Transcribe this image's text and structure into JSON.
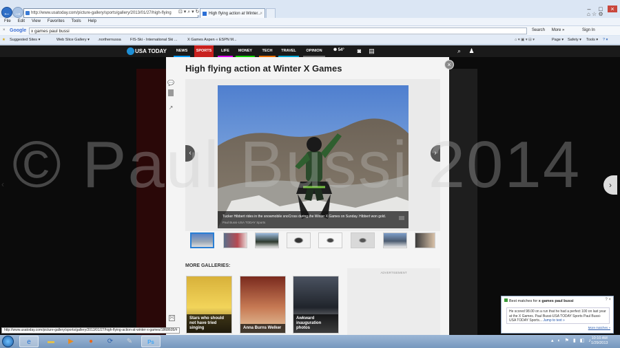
{
  "browser": {
    "url": "http://www.usatoday.com/picture-gallery/sports/gallery/2013/01/27/high-flying",
    "tab_title": "High flying action at Winter...",
    "menu": [
      "File",
      "Edit",
      "View",
      "Favorites",
      "Tools",
      "Help"
    ],
    "google_query": "x games paul bussi",
    "google_label": "Google",
    "google_right": [
      "Search",
      "More »",
      "Sign In"
    ],
    "favorites": [
      "Suggested Sites ▾",
      "Web Slice Gallery ▾",
      ".northernussa",
      "FIS-Ski - International Ski ...",
      "X Games Aspen « ESPN M..."
    ],
    "toolbar_right": [
      "Page ▾",
      "Safety ▾",
      "Tools ▾"
    ],
    "status_url": "http://www.usatoday.com/picture-gallery/sports/gallery/2013/01/27/high-flying-action-at-winter-x-games/1868605/#"
  },
  "site": {
    "logo": "USA TODAY",
    "nav": [
      {
        "label": "NEWS",
        "color": "#1a1a1a",
        "underline": "#0098fe"
      },
      {
        "label": "SPORTS",
        "color": "#c8201d",
        "underline": "#c8201d"
      },
      {
        "label": "LIFE",
        "color": "#1a1a1a",
        "underline": "#db00f0"
      },
      {
        "label": "MONEY",
        "color": "#1a1a1a",
        "underline": "#0fd400"
      },
      {
        "label": "TECH",
        "color": "#1a1a1a",
        "underline": "#e86c00"
      },
      {
        "label": "TRAVEL",
        "color": "#1a1a1a",
        "underline": "#00a5d6"
      },
      {
        "label": "OPINION",
        "color": "#1a1a1a",
        "underline": "#6a6a6a"
      }
    ],
    "weather": "54°"
  },
  "gallery": {
    "title": "High flying action at Winter X Games",
    "caption": "Tucker Hibbert rides in the snowmobile snoCross during the Winter X Games on Sunday. Hibbert won gold.",
    "credit": "Paul Bussi-USA TODAY Sports",
    "selected_thumb": 0,
    "thumb_count": 9,
    "more_header": "MORE GALLERIES:",
    "more": [
      {
        "label": "Stars who should not have tried singing"
      },
      {
        "label": "Anna Burns Welker"
      },
      {
        "label": "Awkward inauguration photos"
      }
    ],
    "ad_label": "ADVERTISEMENT"
  },
  "watermark": "© Paul Bussi 2014",
  "popup": {
    "title_prefix": "Best matches for ",
    "title_query": "x games paul bussi",
    "body_text": "He scored 98.00 on a run that he had a perfect 100 on last year at the X Games. Paul Bussi-USA TODAY Sports Paul Bussi-USA TODAY Sports...",
    "jump": "Jump to text »",
    "more": "More matches »"
  },
  "taskbar": {
    "time": "10:10 AM",
    "date": "1/29/2013"
  }
}
